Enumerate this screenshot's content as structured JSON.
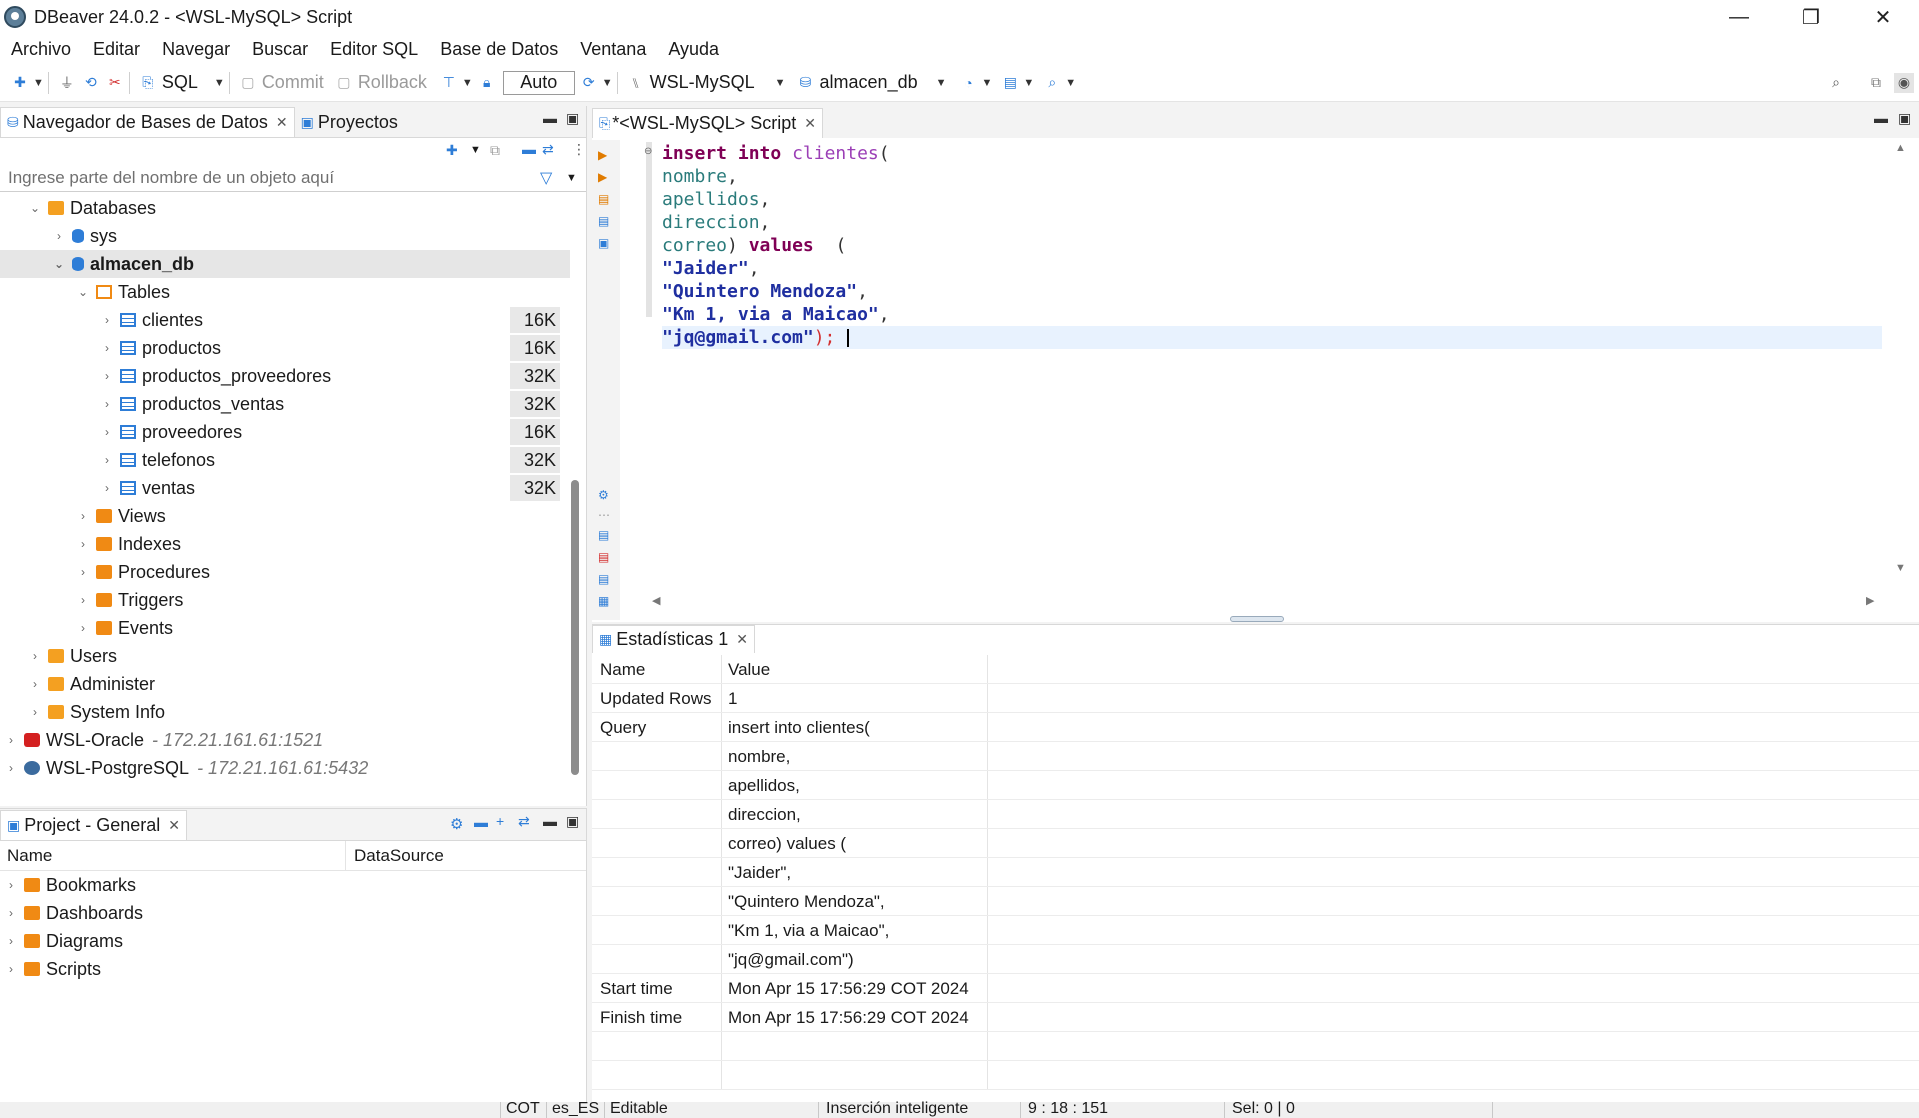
{
  "window": {
    "title": "DBeaver 24.0.2 - <WSL-MySQL> Script",
    "controls": {
      "minimize": "—",
      "maximize": "❐",
      "close": "✕"
    }
  },
  "menu": [
    "Archivo",
    "Editar",
    "Navegar",
    "Buscar",
    "Editor SQL",
    "Base de Datos",
    "Ventana",
    "Ayuda"
  ],
  "toolbar": {
    "sql_label": "SQL",
    "commit_label": "Commit",
    "rollback_label": "Rollback",
    "transaction_mode": "Auto",
    "connection": "WSL-MySQL",
    "database": "almacen_db"
  },
  "navigator": {
    "tab_label": "Navegador de Bases de Datos",
    "projects_tab_label": "Proyectos",
    "filter_placeholder": "Ingrese parte del nombre de un objeto aquí",
    "databases_label": "Databases",
    "sys_label": "sys",
    "selected_db": "almacen_db",
    "tables_label": "Tables",
    "tables": [
      {
        "name": "clientes",
        "size": "16K"
      },
      {
        "name": "productos",
        "size": "16K"
      },
      {
        "name": "productos_proveedores",
        "size": "32K"
      },
      {
        "name": "productos_ventas",
        "size": "32K"
      },
      {
        "name": "proveedores",
        "size": "16K"
      },
      {
        "name": "telefonos",
        "size": "32K"
      },
      {
        "name": "ventas",
        "size": "32K"
      }
    ],
    "folders": [
      "Views",
      "Indexes",
      "Procedures",
      "Triggers",
      "Events"
    ],
    "server_items": [
      "Users",
      "Administer",
      "System Info"
    ],
    "connections": [
      {
        "name": "WSL-Oracle",
        "host": "- 172.21.161.61:1521"
      },
      {
        "name": "WSL-PostgreSQL",
        "host": "- 172.21.161.61:5432"
      }
    ]
  },
  "project": {
    "tab_label": "Project - General",
    "col_name": "Name",
    "col_datasource": "DataSource",
    "items": [
      "Bookmarks",
      "Dashboards",
      "Diagrams",
      "Scripts"
    ]
  },
  "editor": {
    "tab_label": "*<WSL-MySQL> Script",
    "code": {
      "kw_insert": "insert",
      "kw_into": "into",
      "table": "clientes",
      "open_paren": "(",
      "cols": [
        "nombre",
        "apellidos",
        "direccion",
        "correo"
      ],
      "kw_values": "values",
      "open_paren2": "(",
      "strings": [
        "\"Jaider\"",
        "\"Quintero Mendoza\"",
        "\"Km 1, via a Maicao\"",
        "\"jq@gmail.com\""
      ],
      "close": ");"
    }
  },
  "results": {
    "tab_label": "Estadísticas 1",
    "header_name": "Name",
    "header_value": "Value",
    "rows": [
      {
        "k": "Updated Rows",
        "v": "1"
      },
      {
        "k": "Query",
        "v": "insert into clientes("
      },
      {
        "k": "",
        "v": "nombre,"
      },
      {
        "k": "",
        "v": "apellidos,"
      },
      {
        "k": "",
        "v": "direccion,"
      },
      {
        "k": "",
        "v": "correo) values ("
      },
      {
        "k": "",
        "v": "\"Jaider\","
      },
      {
        "k": "",
        "v": "\"Quintero Mendoza\","
      },
      {
        "k": "",
        "v": "\"Km 1, via a Maicao\","
      },
      {
        "k": "",
        "v": "\"jq@gmail.com\")"
      },
      {
        "k": "Start time",
        "v": "Mon Apr 15 17:56:29 COT 2024"
      },
      {
        "k": "Finish time",
        "v": "Mon Apr 15 17:56:29 COT 2024"
      }
    ]
  },
  "status": {
    "timezone": "COT",
    "locale": "es_ES",
    "mode": "Editable",
    "insert_mode": "Inserción inteligente",
    "position": "9 : 18 : 151",
    "selection": "Sel: 0 | 0"
  }
}
